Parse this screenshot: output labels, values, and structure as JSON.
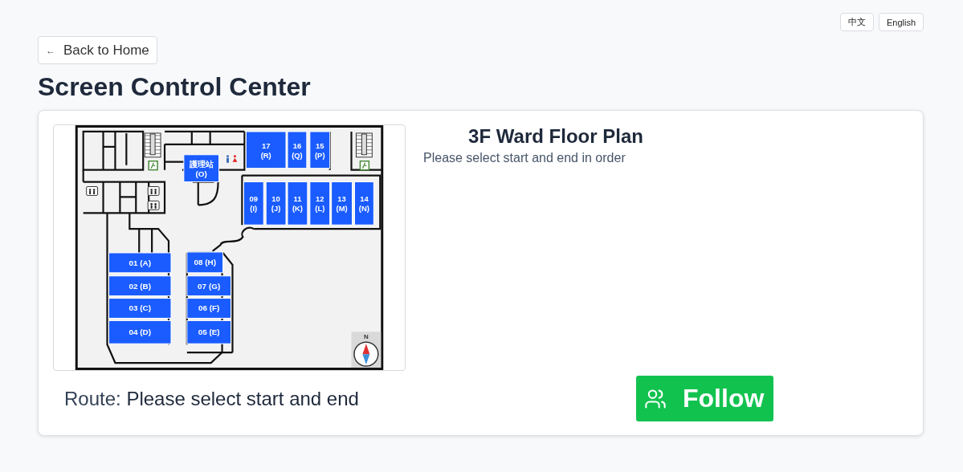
{
  "language_buttons": [
    {
      "label": "中文"
    },
    {
      "label": "English"
    }
  ],
  "back_button": {
    "icon": "←",
    "label": "Back to Home"
  },
  "page_title": "Screen Control Center",
  "floor_plan": {
    "compass_label": "N",
    "rooms": [
      {
        "number": "17",
        "letter": "(R)"
      },
      {
        "number": "16",
        "letter": "(Q)"
      },
      {
        "number": "15",
        "letter": "(P)"
      },
      {
        "number": "護理站",
        "letter": "(O)"
      },
      {
        "number": "09",
        "letter": "(I)"
      },
      {
        "number": "10",
        "letter": "(J)"
      },
      {
        "number": "11",
        "letter": "(K)"
      },
      {
        "number": "12",
        "letter": "(L)"
      },
      {
        "number": "13",
        "letter": "(M)"
      },
      {
        "number": "14",
        "letter": "(N)"
      },
      {
        "number": "01",
        "letter": "(A)"
      },
      {
        "number": "08",
        "letter": "(H)"
      },
      {
        "number": "02",
        "letter": "(B)"
      },
      {
        "number": "07",
        "letter": "(G)"
      },
      {
        "number": "03",
        "letter": "(C)"
      },
      {
        "number": "06",
        "letter": "(F)"
      },
      {
        "number": "04",
        "letter": "(D)"
      },
      {
        "number": "05",
        "letter": "(E)"
      }
    ]
  },
  "plan_title": "3F Ward Floor Plan",
  "instruction": "Please select start and end in order",
  "route": {
    "label": "Route:",
    "value": "Please select start and end"
  },
  "follow_button": {
    "label": "Follow"
  }
}
